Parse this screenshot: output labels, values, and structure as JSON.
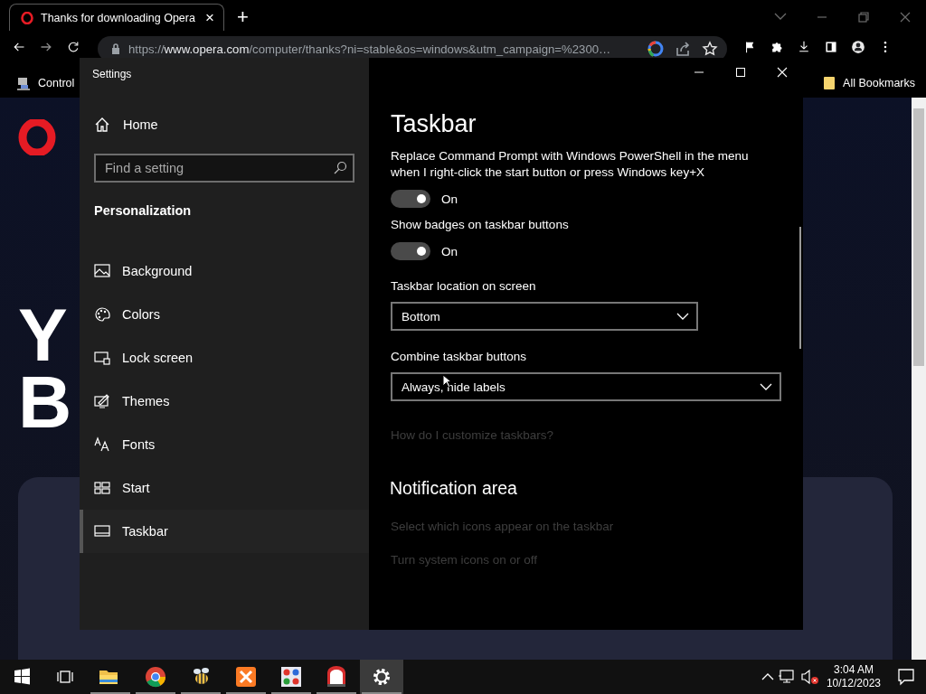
{
  "browser": {
    "tabs": [
      {
        "title": "Thanks for downloading Opera",
        "selected": true,
        "close": "×"
      }
    ],
    "new_tab": "+",
    "address": {
      "scheme": "https://",
      "host": "www.opera.com",
      "path": "/computer/thanks?ni=stable&os=windows&utm_campaign=%2300…"
    },
    "bookmarks": [
      {
        "label": "Control"
      }
    ],
    "all_bookmarks": "All Bookmarks"
  },
  "page": {
    "headline": [
      "Y",
      "B"
    ]
  },
  "settings": {
    "title": "Settings",
    "home": "Home",
    "search": {
      "placeholder": "Find a setting"
    },
    "section": "Personalization",
    "nav": [
      {
        "label": "Background",
        "selected": false
      },
      {
        "label": "Colors",
        "selected": false
      },
      {
        "label": "Lock screen",
        "selected": false
      },
      {
        "label": "Themes",
        "selected": false
      },
      {
        "label": "Fonts",
        "selected": false
      },
      {
        "label": "Start",
        "selected": false
      },
      {
        "label": "Taskbar",
        "selected": true
      }
    ],
    "heading": "Taskbar",
    "items": [
      {
        "kind": "toggle",
        "label": "Replace Command Prompt with Windows PowerShell in the menu when I right-click the start button or press Windows key+X",
        "on": true,
        "state": "On"
      },
      {
        "kind": "toggle",
        "label": "Show badges on taskbar buttons",
        "on": true,
        "state": "On"
      },
      {
        "kind": "dropdown",
        "label": "Taskbar location on screen",
        "value": "Bottom"
      },
      {
        "kind": "dropdown",
        "label": "Combine taskbar buttons",
        "value": "Always, hide labels"
      },
      {
        "kind": "link",
        "text": "How do I customize taskbars?"
      },
      {
        "kind": "heading",
        "text": "Notification area"
      },
      {
        "kind": "link",
        "text": "Select which icons appear on the taskbar"
      },
      {
        "kind": "link",
        "text": "Turn system icons on or off"
      }
    ]
  },
  "taskbar": {
    "apps": [
      {
        "running": true,
        "active": false
      },
      {
        "running": true,
        "active": false
      },
      {
        "running": true,
        "active": false
      },
      {
        "running": true,
        "active": false
      },
      {
        "running": true,
        "active": false
      },
      {
        "running": true,
        "active": false
      },
      {
        "running": true,
        "active": true
      }
    ],
    "clock": {
      "time": "3:04 AM",
      "date": "10/12/2023"
    }
  }
}
